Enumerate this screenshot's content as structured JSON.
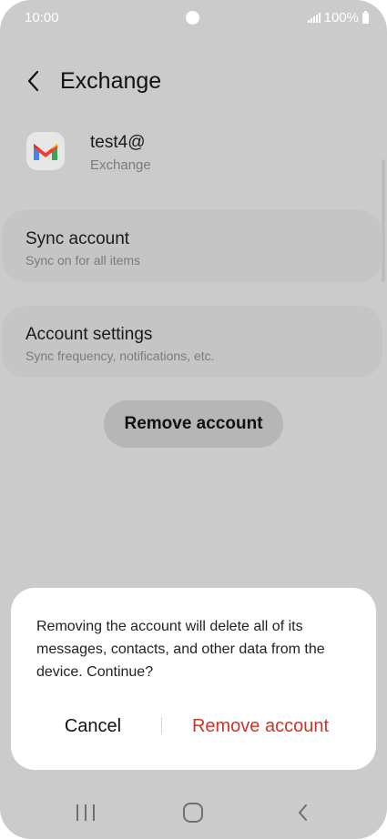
{
  "status_bar": {
    "time": "10:00",
    "battery": "100%",
    "icons": [
      "signal-icon",
      "battery-icon"
    ]
  },
  "header": {
    "title": "Exchange",
    "back_icon": "back-arrow-icon"
  },
  "account": {
    "name": "test4@",
    "type": "Exchange",
    "icon": "gmail-icon"
  },
  "sync_card": {
    "title": "Sync account",
    "subtitle": "Sync on for all items"
  },
  "settings_card": {
    "title": "Account settings",
    "subtitle": "Sync frequency, notifications, etc."
  },
  "remove_button": {
    "label": "Remove account"
  },
  "dialog": {
    "message": "Removing the account will delete all of its messages, contacts, and other data from the device. Continue?",
    "cancel_label": "Cancel",
    "confirm_label": "Remove account"
  },
  "nav_bar": {
    "icons": [
      "recents-icon",
      "home-icon",
      "back-icon"
    ]
  },
  "colors": {
    "dim_background": "#cbcbcb",
    "card": "#c5c5c5",
    "dialog": "#ffffff",
    "destructive": "#cc3529"
  }
}
